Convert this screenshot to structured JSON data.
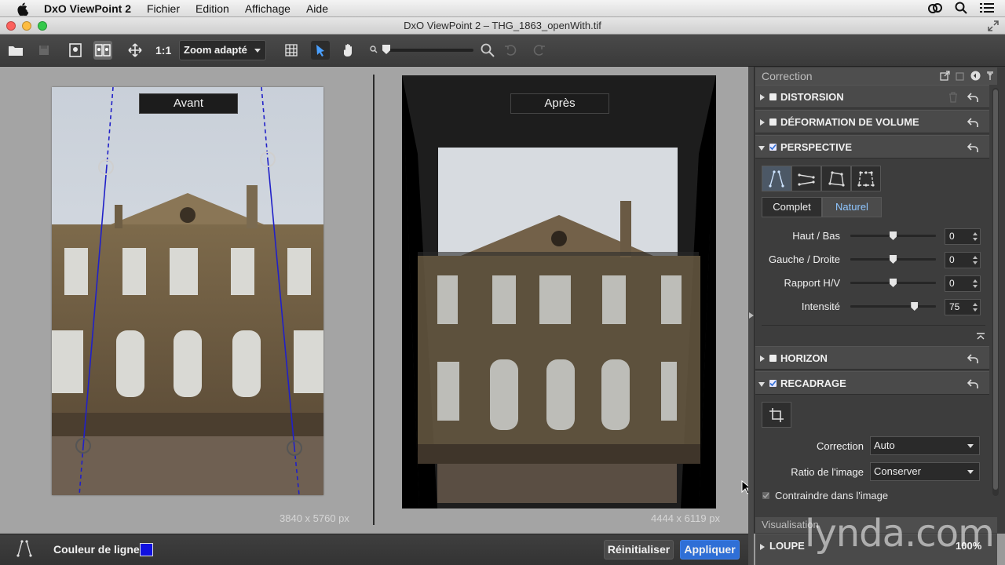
{
  "menubar": {
    "app_name": "DxO ViewPoint 2",
    "items": [
      "Fichier",
      "Edition",
      "Affichage",
      "Aide"
    ]
  },
  "window": {
    "title": "DxO ViewPoint 2 – THG_1863_openWith.tif"
  },
  "toolbar": {
    "one_to_one": "1:1",
    "zoom_value": "Zoom adapté"
  },
  "canvas": {
    "before_label": "Avant",
    "after_label": "Après",
    "before_dimensions": "3840 x 5760 px",
    "after_dimensions": "4444 x 6119 px"
  },
  "panel": {
    "header": "Correction",
    "sections": {
      "distorsion": "DISTORSION",
      "deformation": "DÉFORMATION DE VOLUME",
      "perspective": "PERSPECTIVE",
      "horizon": "HORIZON",
      "recadrage": "RECADRAGE"
    },
    "perspective": {
      "mode_complet": "Complet",
      "mode_naturel": "Naturel",
      "params": [
        {
          "label": "Haut / Bas",
          "value": "0",
          "level": 0.5
        },
        {
          "label": "Gauche / Droite",
          "value": "0",
          "level": 0.5
        },
        {
          "label": "Rapport H/V",
          "value": "0",
          "level": 0.5
        },
        {
          "label": "Intensité",
          "value": "75",
          "level": 0.75
        }
      ]
    },
    "recadrage": {
      "correction_label": "Correction",
      "correction_value": "Auto",
      "ratio_label": "Ratio de l'image",
      "ratio_value": "Conserver",
      "constrain_label": "Contraindre dans l'image"
    },
    "visualisation": "Visualisation",
    "loupe": "LOUPE",
    "loupe_zoom": "100%"
  },
  "bottombar": {
    "line_color_label": "Couleur de ligne",
    "line_color": "#1010e0",
    "reset_label": "Réinitialiser",
    "apply_label": "Appliquer"
  },
  "watermark": "lynda.com",
  "colors": {
    "accent": "#2f6fd6",
    "guide_line": "#2020c8"
  }
}
